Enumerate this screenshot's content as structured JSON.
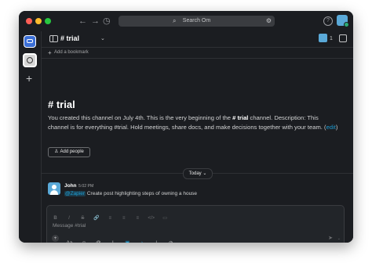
{
  "titlebar": {
    "back_icon": "←",
    "forward_icon": "→",
    "history_icon": "◷",
    "search_placeholder": "Search Om",
    "help_icon": "?"
  },
  "channel": {
    "name": "# trial",
    "member_count": "1",
    "bookmark_label": "Add a bookmark"
  },
  "intro": {
    "title": "# trial",
    "text_before": "You created this channel on July 4th. This is the very beginning of the ",
    "channel_bold": "# trial",
    "text_after": " channel. Description: This channel is for everything #trial. Hold meetings, share docs, and make decisions together with your team. (",
    "edit_link": "edit",
    "text_close": ")",
    "add_people": "Add people"
  },
  "divider": {
    "date_label": "Today"
  },
  "message": {
    "author": "John",
    "time": "5:02 PM",
    "mention": "@Zapier",
    "text": "Create post highlighting steps of owning a house"
  },
  "composer": {
    "placeholder": "Message #trial",
    "format_icons": [
      "B",
      "I",
      "S",
      "🔗",
      "≡",
      "≡",
      "≡",
      "</>",
      "▭"
    ]
  },
  "colors": {
    "background": "#1b1d21",
    "accent_link": "#1d9bd1",
    "workspace_active": "#3b6fd6",
    "avatar": "#5aa9d8",
    "online": "#2bac76"
  }
}
